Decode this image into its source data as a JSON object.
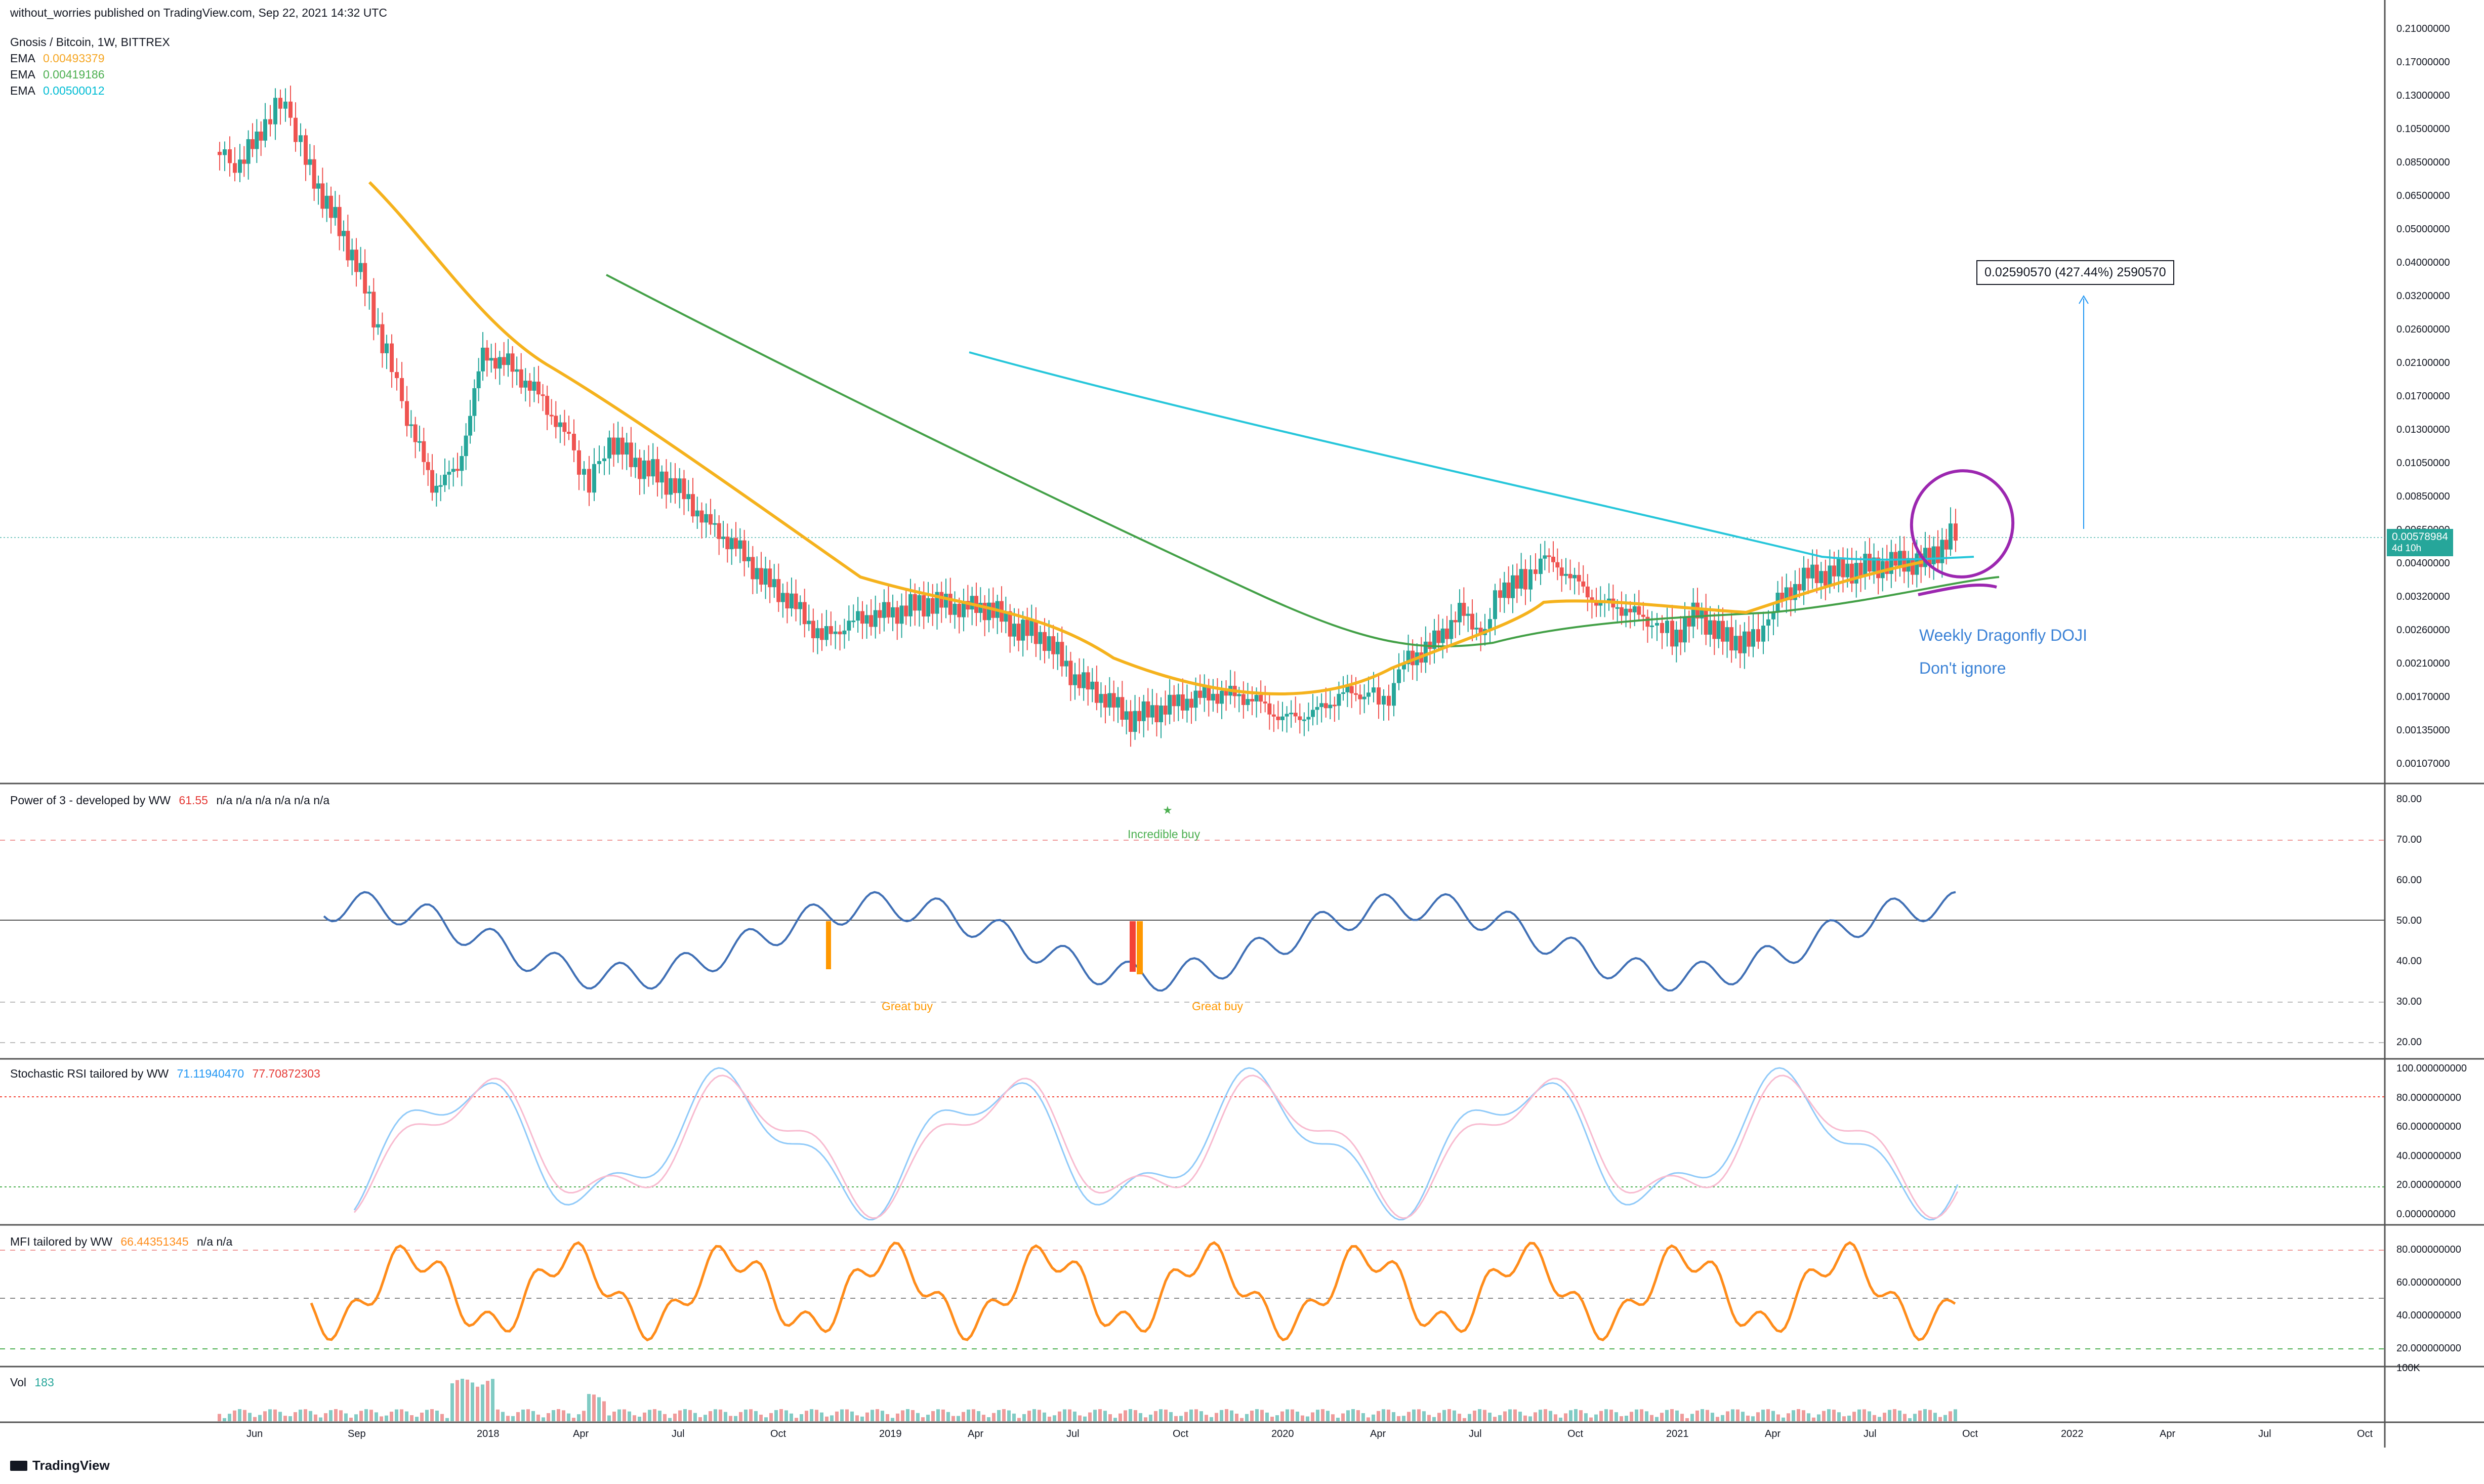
{
  "publish_line": "without_worries published on TradingView.com, Sep 22, 2021 14:32 UTC",
  "symbol_line": "Gnosis / Bitcoin, 1W, BITTREX",
  "ema": [
    {
      "label": "EMA",
      "value": "0.00493379",
      "color": "#f5a623"
    },
    {
      "label": "EMA",
      "value": "0.00419186",
      "color": "#4caf50"
    },
    {
      "label": "EMA",
      "value": "0.00500012",
      "color": "#00bcd4"
    }
  ],
  "price_axis": [
    "0.21000000",
    "0.17000000",
    "0.13000000",
    "0.10500000",
    "0.08500000",
    "0.06500000",
    "0.05000000",
    "0.04000000",
    "0.03200000",
    "0.02600000",
    "0.02100000",
    "0.01700000",
    "0.01300000",
    "0.01050000",
    "0.00850000",
    "0.00650000",
    "0.00400000",
    "0.00320000",
    "0.00260000",
    "0.00210000",
    "0.00170000",
    "0.00135000",
    "0.00107000"
  ],
  "price_tag": {
    "value": "0.00578984",
    "countdown": "4d 10h",
    "color": "#26a69a"
  },
  "measure_box": "0.02590570 (427.44%) 2590570",
  "annotations": {
    "doji": "Weekly Dragonfly DOJI",
    "ignore": "Don't ignore"
  },
  "power3": {
    "title": "Power of 3 - developed by WW",
    "value": "61.55",
    "na": "n/a  n/a  n/a  n/a  n/a  n/a",
    "axis": [
      "80.00",
      "70.00",
      "60.00",
      "50.00",
      "40.00",
      "30.00",
      "20.00"
    ],
    "star": "★",
    "incredible": "Incredible buy",
    "great1": "Great buy",
    "great2": "Great buy"
  },
  "stoch": {
    "title": "Stochastic RSI tailored by WW",
    "k": "71.11940470",
    "d": "77.70872303",
    "axis": [
      "100.000000000",
      "80.000000000",
      "60.000000000",
      "40.000000000",
      "20.000000000",
      "0.000000000"
    ]
  },
  "mfi": {
    "title": "MFI tailored by WW",
    "value": "66.44351345",
    "na": "n/a  n/a",
    "axis": [
      "80.000000000",
      "60.000000000",
      "40.000000000",
      "20.000000000"
    ]
  },
  "vol": {
    "title": "Vol",
    "value": "183",
    "axis_top": "100K"
  },
  "time_axis": [
    "Jun",
    "Sep",
    "2018",
    "Apr",
    "Jul",
    "Oct",
    "2019",
    "Apr",
    "Jul",
    "Oct",
    "2020",
    "Apr",
    "Jul",
    "Oct",
    "2021",
    "Apr",
    "Jul",
    "Oct",
    "2022",
    "Apr",
    "Jul",
    "Oct"
  ],
  "logo": "TradingView"
}
